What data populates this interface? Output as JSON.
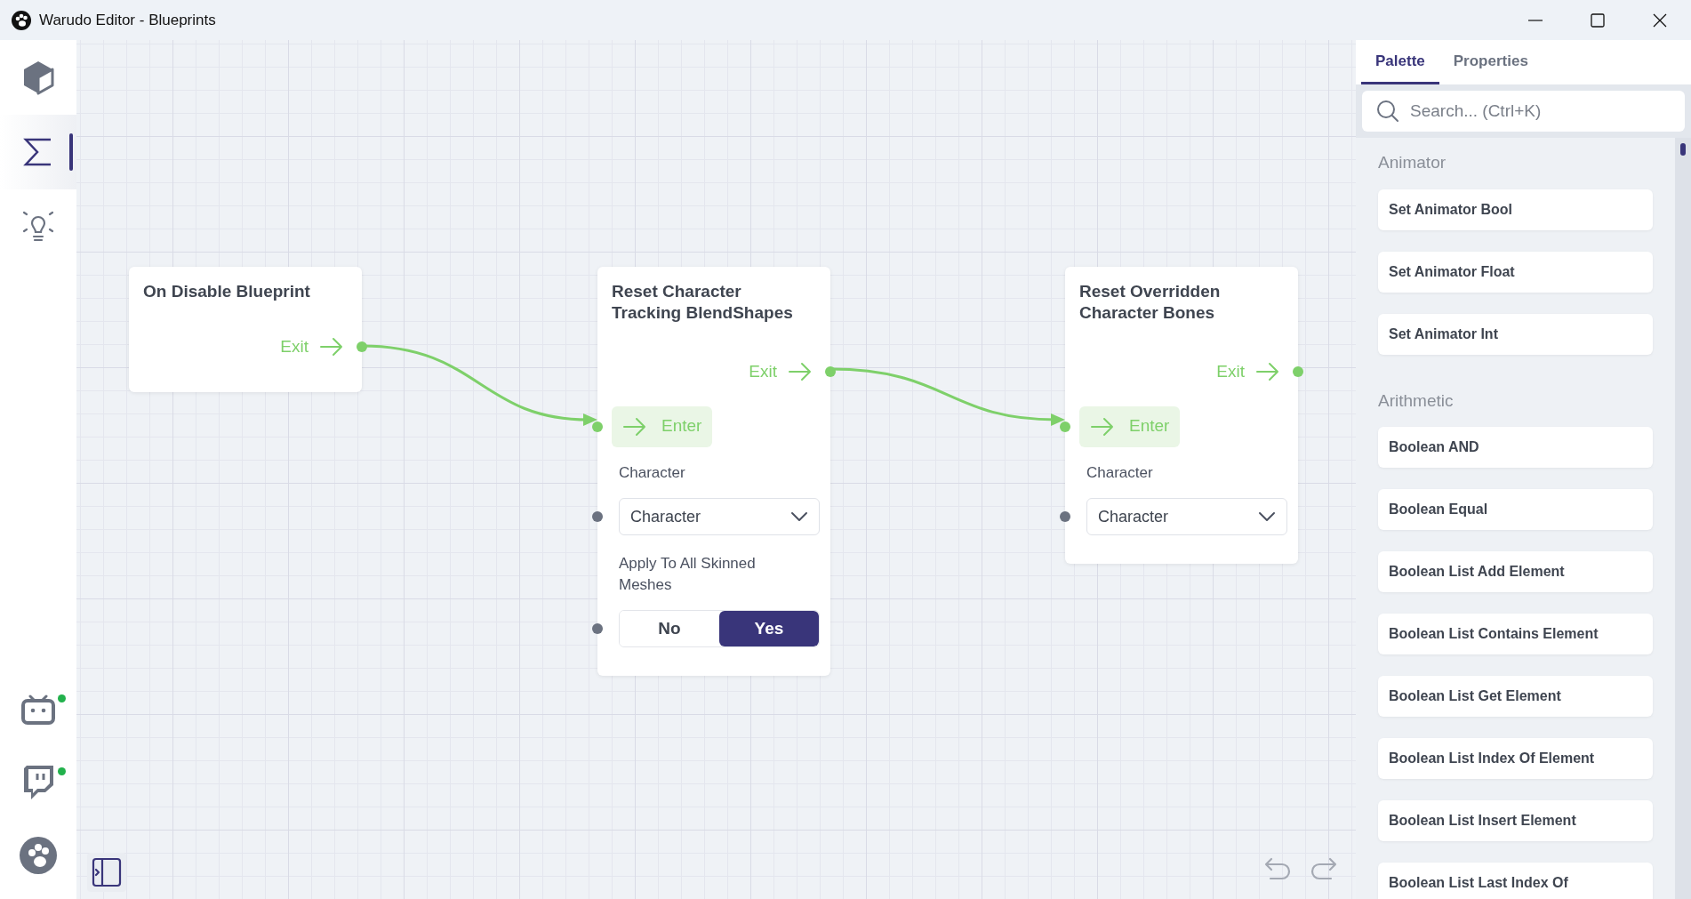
{
  "window": {
    "title": "Warudo Editor - Blueprints"
  },
  "sidebar": {
    "top_items": [
      {
        "selected": false
      },
      {
        "selected": true
      },
      {
        "selected": false
      }
    ],
    "bottom_items": [
      {
        "online": true
      },
      {
        "online": true
      },
      {
        "online": false
      }
    ]
  },
  "nodes": [
    {
      "title": "On Disable Blueprint",
      "exit": {
        "label": "Exit"
      }
    },
    {
      "title": "Reset Character Tracking BlendShapes",
      "exit": {
        "label": "Exit"
      },
      "enter": {
        "label": "Enter"
      },
      "fields": [
        {
          "kind": "dropdown",
          "label": "Character",
          "value": "Character"
        },
        {
          "kind": "toggle",
          "label": "Apply To All Skinned Meshes",
          "options": [
            {
              "label": "No",
              "selected": false
            },
            {
              "label": "Yes",
              "selected": true
            }
          ]
        }
      ]
    },
    {
      "title": "Reset Overridden Character Bones",
      "exit": {
        "label": "Exit"
      },
      "enter": {
        "label": "Enter"
      },
      "fields": [
        {
          "kind": "dropdown",
          "label": "Character",
          "value": "Character"
        }
      ]
    }
  ],
  "panel": {
    "tabs": [
      {
        "label": "Palette",
        "selected": true
      },
      {
        "label": "Properties",
        "selected": false
      }
    ],
    "search": {
      "placeholder": "Search... (Ctrl+K)"
    },
    "groups": [
      {
        "title": "Animator",
        "items": [
          "Set Animator Bool",
          "Set Animator Float",
          "Set Animator Int"
        ]
      },
      {
        "title": "Arithmetic",
        "items": [
          "Boolean AND",
          "Boolean Equal",
          "Boolean List Add Element",
          "Boolean List Contains Element",
          "Boolean List Get Element",
          "Boolean List Index Of Element",
          "Boolean List Insert Element",
          "Boolean List Last Index Of"
        ]
      }
    ]
  }
}
